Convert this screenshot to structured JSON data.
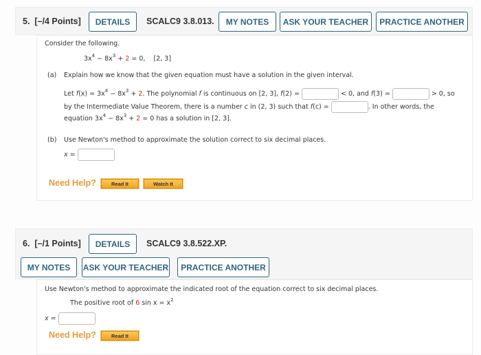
{
  "q5": {
    "number": "5.",
    "points": "[–/4 Points]",
    "details_label": "DETAILS",
    "code": "SCALC9 3.8.013.",
    "my_notes_label": "MY NOTES",
    "ask_teacher_label": "ASK YOUR TEACHER",
    "practice_label": "PRACTICE ANOTHER",
    "intro": "Consider the following.",
    "equation": {
      "a": "3x",
      "e1": "4",
      "b": " − 8x",
      "e2": "3",
      "c": " + ",
      "const": "2",
      "d": " = 0,",
      "interval": "[2, 3]"
    },
    "part_a": {
      "label": "(a)",
      "prompt": "Explain how we know that the given equation must have a solution in the given interval.",
      "line1_a": "Let ",
      "fx": "f",
      "line1_b": "(x) = 3x",
      "e1": "4",
      "line1_c": " − 8x",
      "e2": "3",
      "line1_d": " + ",
      "const": "2",
      "line1_e": ". The polynomial ",
      "f": "f",
      "line1_f": " is continuous on [2, 3], ",
      "f2": "f",
      "line1_g": "(2) = ",
      "line1_h": " < 0, and ",
      "f3": "f",
      "line1_i": "(3) = ",
      "line1_j": " > 0, so",
      "line2_a": "by the Intermediate Value Theorem, there is a number ",
      "c": "c",
      "line2_b": " in (2, 3) such that ",
      "fc": "f",
      "line2_c": "(c) = ",
      "line2_d": ". In other words, the",
      "line3_a": "equation 3x",
      "line3_b": " − 8x",
      "line3_c": " + ",
      "line3_d": " = 0 has a solution in [2, 3].",
      "f2_value": "",
      "f3_value": "",
      "fc_value": ""
    },
    "part_b": {
      "label": "(b)",
      "prompt": "Use Newton's method to approximate the solution correct to six decimal places.",
      "x_label": "x =",
      "x_value": ""
    },
    "need_help": "Need Help?",
    "read_it": "Read It",
    "watch_it": "Watch It"
  },
  "q6": {
    "number": "6.",
    "points": "[–/1 Points]",
    "details_label": "DETAILS",
    "code": "SCALC9 3.8.522.XP.",
    "my_notes_label": "MY NOTES",
    "ask_teacher_label": "ASK YOUR TEACHER",
    "practice_label": "PRACTICE ANOTHER",
    "prompt": "Use Newton's method to approximate the indicated root of the equation correct to six decimal places.",
    "root_a": "The positive root of ",
    "root_const": "6",
    "root_b": " sin x = x",
    "root_exp": "2",
    "x_label": "x =",
    "x_value": "",
    "need_help": "Need Help?",
    "read_it": "Read It"
  }
}
